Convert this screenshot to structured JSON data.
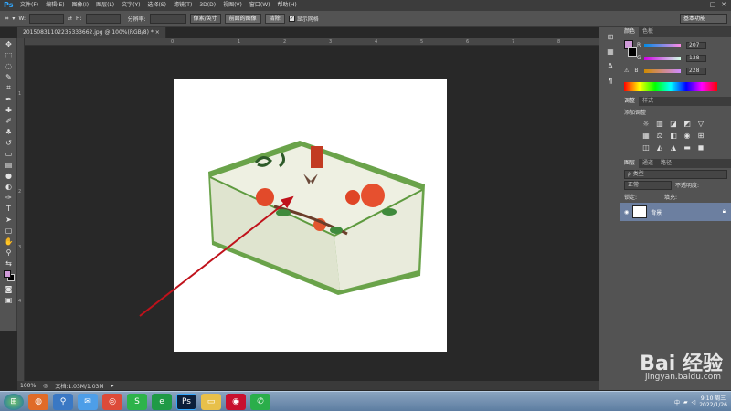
{
  "app": {
    "logo": "Ps"
  },
  "menu": [
    "文件(F)",
    "编辑(E)",
    "图像(I)",
    "图层(L)",
    "文字(Y)",
    "选择(S)",
    "滤镜(T)",
    "3D(D)",
    "视图(V)",
    "窗口(W)",
    "帮助(H)"
  ],
  "options": {
    "w_label": "W:",
    "h_label": "H:",
    "resolution_label": "分辨率:",
    "unit_select": "像素/英寸",
    "front_image_button": "前面的图像",
    "clear_button": "清除",
    "show_grid_label": "显示网格",
    "show_grid_checked": true,
    "workspace": "基本功能"
  },
  "document": {
    "tab_title": "20150831102235333662.jpg @ 100%(RGB/8) * ×"
  },
  "rulers": {
    "top": [
      "0",
      "1",
      "2",
      "3",
      "4",
      "5",
      "6",
      "7",
      "8"
    ],
    "left": [
      "1",
      "2",
      "3",
      "4"
    ]
  },
  "status": {
    "zoom": "100%",
    "doc_size": "文档:1.03M/1.03M"
  },
  "colors": {
    "foreground": "#cf9ad8",
    "background": "#000000",
    "arrow": "#c0121b"
  },
  "color_panel": {
    "tabs": [
      "颜色",
      "色板"
    ],
    "r_label": "R",
    "r_value": "207",
    "g_label": "G",
    "g_value": "138",
    "b_label": "B",
    "b_value": "228"
  },
  "adjust_panel": {
    "tabs": [
      "调整",
      "样式"
    ],
    "title": "添加调整"
  },
  "layers_panel": {
    "tabs": [
      "图层",
      "通道",
      "路径"
    ],
    "filter_label": "ρ 类型",
    "blend_mode": "正常",
    "opacity_label": "不透明度:",
    "lock_label": "锁定:",
    "fill_label": "填充:",
    "layer_name": "背景"
  },
  "taskbar": {
    "clock_time": "9:10 周三",
    "clock_date": "2022/1/26",
    "ime": "中"
  },
  "watermark": {
    "text": "Bai 经验",
    "url": "jingyan.baidu.com"
  }
}
